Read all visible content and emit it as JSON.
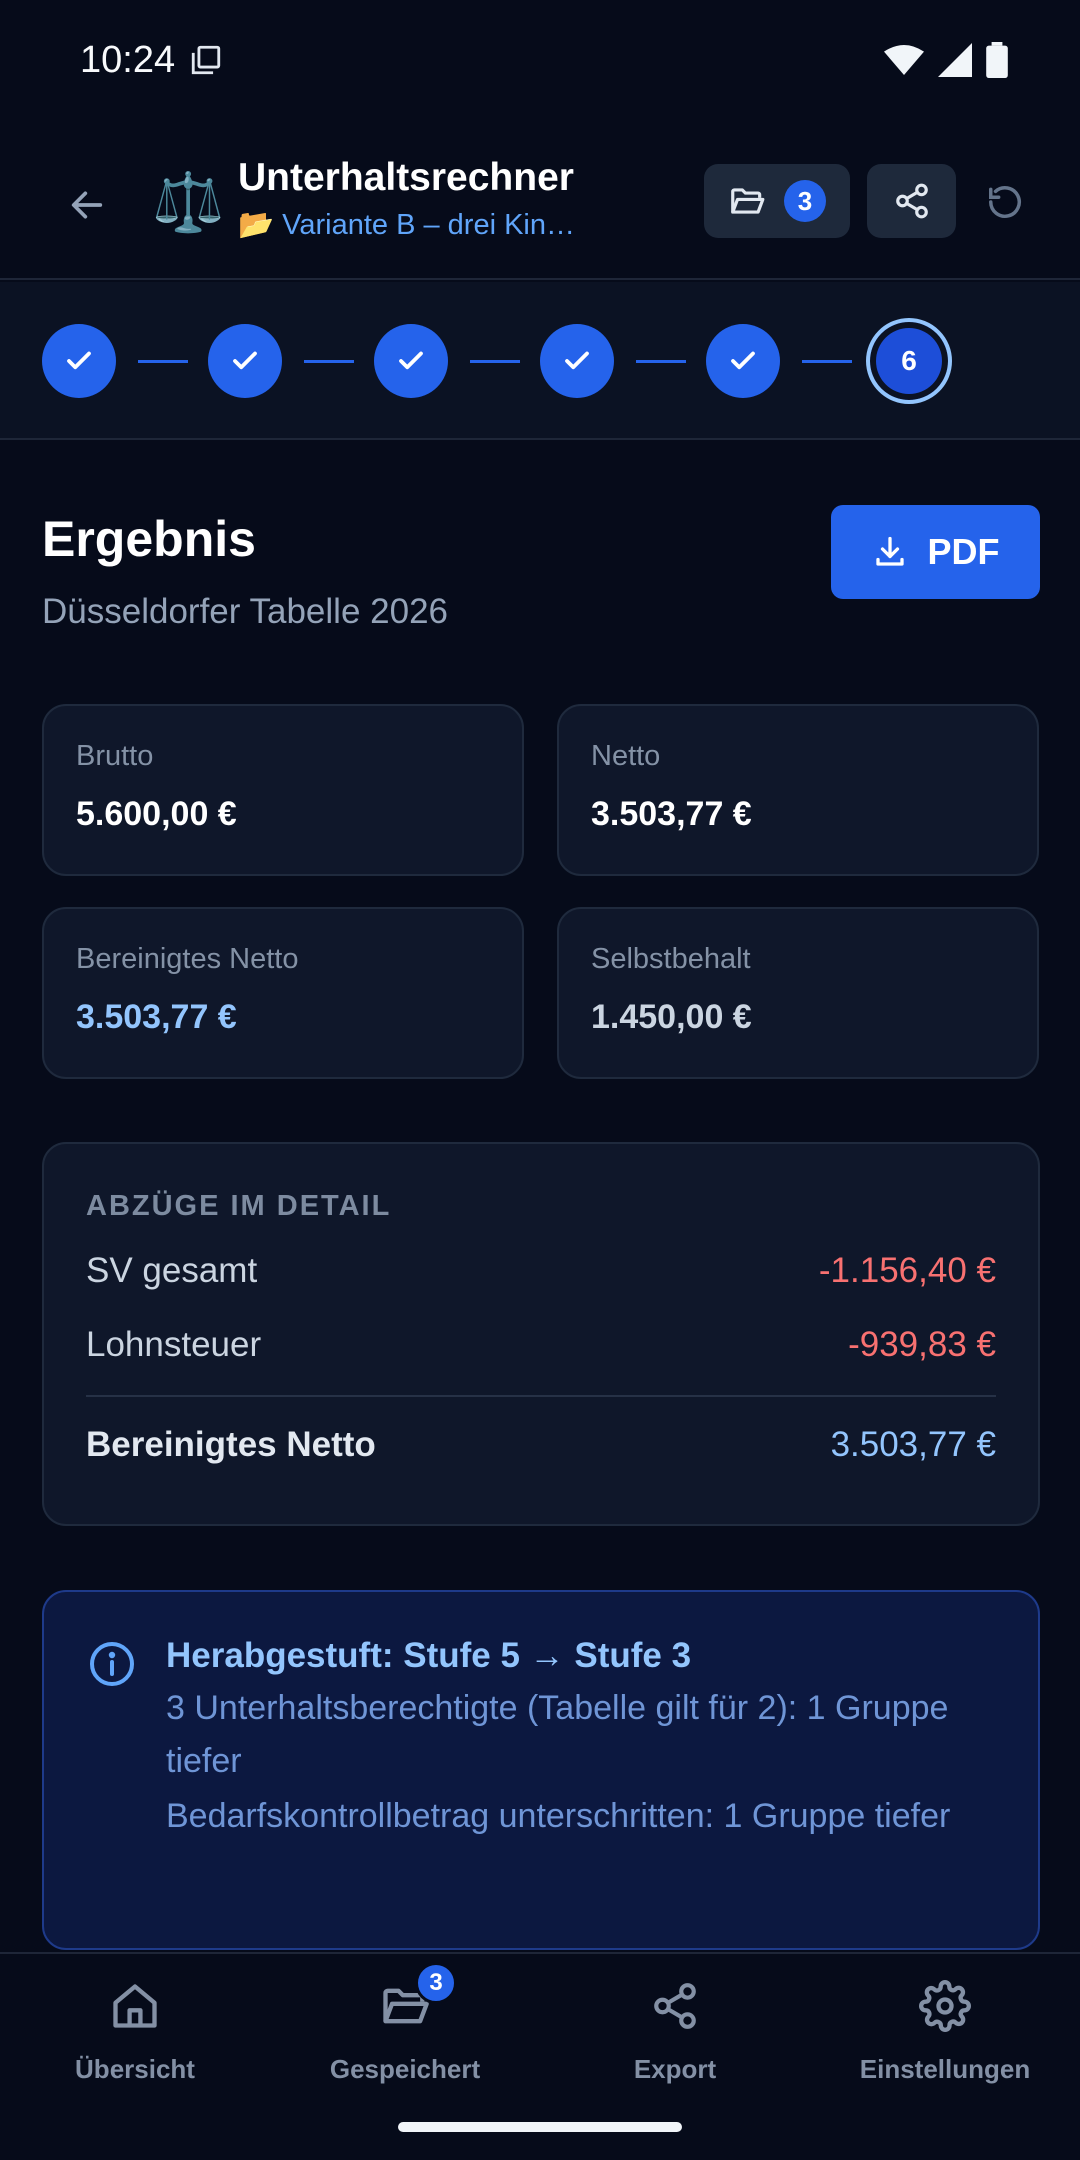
{
  "status_bar": {
    "time": "10:24"
  },
  "app_bar": {
    "title": "Unterhaltsrechner",
    "subtitle": "📂 Variante B – drei Kin…",
    "logo_glyph": "⚖️",
    "saved_count": "3"
  },
  "stepper": {
    "completed_steps": 5,
    "current_step": "6"
  },
  "result": {
    "title": "Ergebnis",
    "subtitle": "Düsseldorfer Tabelle 2026",
    "pdf_label": "PDF"
  },
  "cards": {
    "brutto": {
      "label": "Brutto",
      "value": "5.600,00 €"
    },
    "netto": {
      "label": "Netto",
      "value": "3.503,77 €"
    },
    "bereinigt": {
      "label": "Bereinigtes Netto",
      "value": "3.503,77 €"
    },
    "selbstbehalt": {
      "label": "Selbstbehalt",
      "value": "1.450,00 €"
    }
  },
  "deductions": {
    "heading": "ABZÜGE IM DETAIL",
    "rows": [
      {
        "label": "SV gesamt",
        "value": "-1.156,40 €"
      },
      {
        "label": "Lohnsteuer",
        "value": "-939,83 €"
      }
    ],
    "total": {
      "label": "Bereinigtes Netto",
      "value": "3.503,77 €"
    }
  },
  "info": {
    "title": "Herabgestuft: Stufe 5 → Stufe 3",
    "lines": [
      "3 Unterhaltsberechtigte (Tabelle gilt für 2): 1 Gruppe tiefer",
      "Bedarfskontrollbetrag unterschritten: 1 Gruppe tiefer"
    ]
  },
  "bottom_nav": {
    "items": [
      {
        "label": "Übersicht",
        "icon": "home-icon"
      },
      {
        "label": "Gespeichert",
        "icon": "folder-icon",
        "badge": "3"
      },
      {
        "label": "Export",
        "icon": "share-icon"
      },
      {
        "label": "Einstellungen",
        "icon": "gear-icon"
      }
    ]
  },
  "colors": {
    "background": "#060b1a",
    "accent": "#2563eb",
    "negative": "#f87171",
    "highlight": "#93c5fd"
  }
}
